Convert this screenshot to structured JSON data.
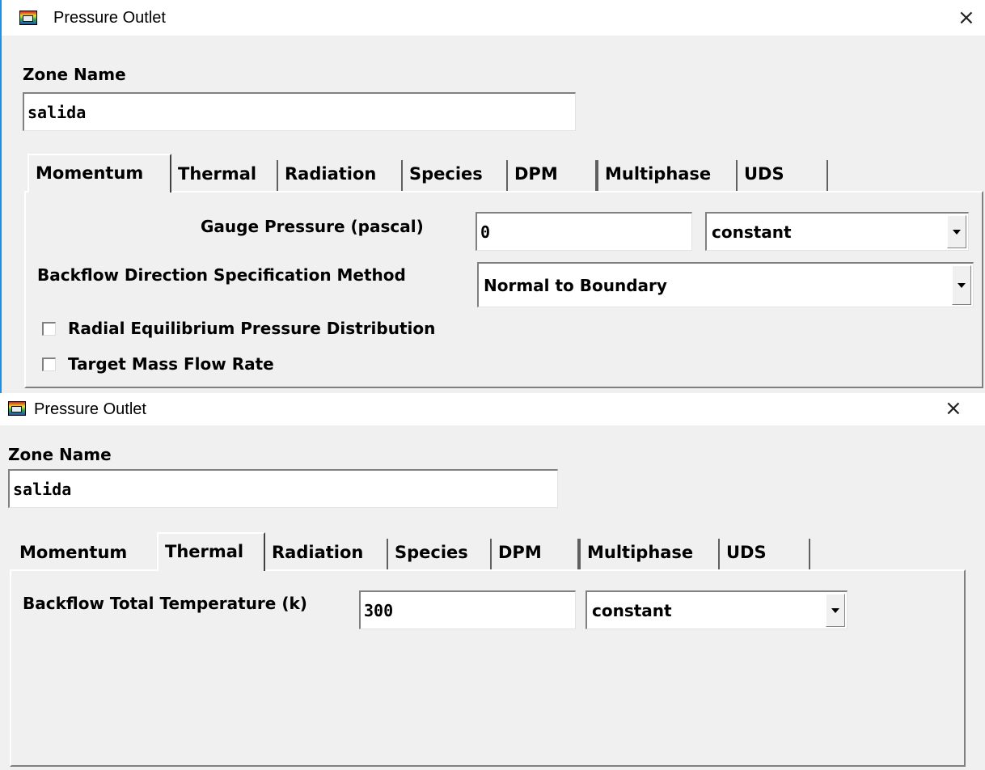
{
  "window1": {
    "title": "Pressure Outlet",
    "close_glyph": "×",
    "zone_name_label": "Zone Name",
    "zone_name_value": "salida",
    "tabs": [
      "Momentum",
      "Thermal",
      "Radiation",
      "Species",
      "DPM",
      "Multiphase",
      "UDS"
    ],
    "active_tab": "Momentum",
    "gauge_pressure_label": "Gauge Pressure (pascal)",
    "gauge_pressure_value": "0",
    "gauge_pressure_method": "constant",
    "backflow_label": "Backflow Direction Specification Method",
    "backflow_value": "Normal to Boundary",
    "radial_eq_label": "Radial Equilibrium Pressure Distribution",
    "radial_eq_checked": false,
    "target_mass_label": "Target Mass Flow Rate",
    "target_mass_checked": false
  },
  "window2": {
    "title": "Pressure Outlet",
    "close_glyph": "×",
    "zone_name_label": "Zone Name",
    "zone_name_value": "salida",
    "tabs": [
      "Momentum",
      "Thermal",
      "Radiation",
      "Species",
      "DPM",
      "Multiphase",
      "UDS"
    ],
    "active_tab": "Thermal",
    "backflow_temp_label": "Backflow Total Temperature (k)",
    "backflow_temp_value": "300",
    "backflow_temp_method": "constant"
  }
}
